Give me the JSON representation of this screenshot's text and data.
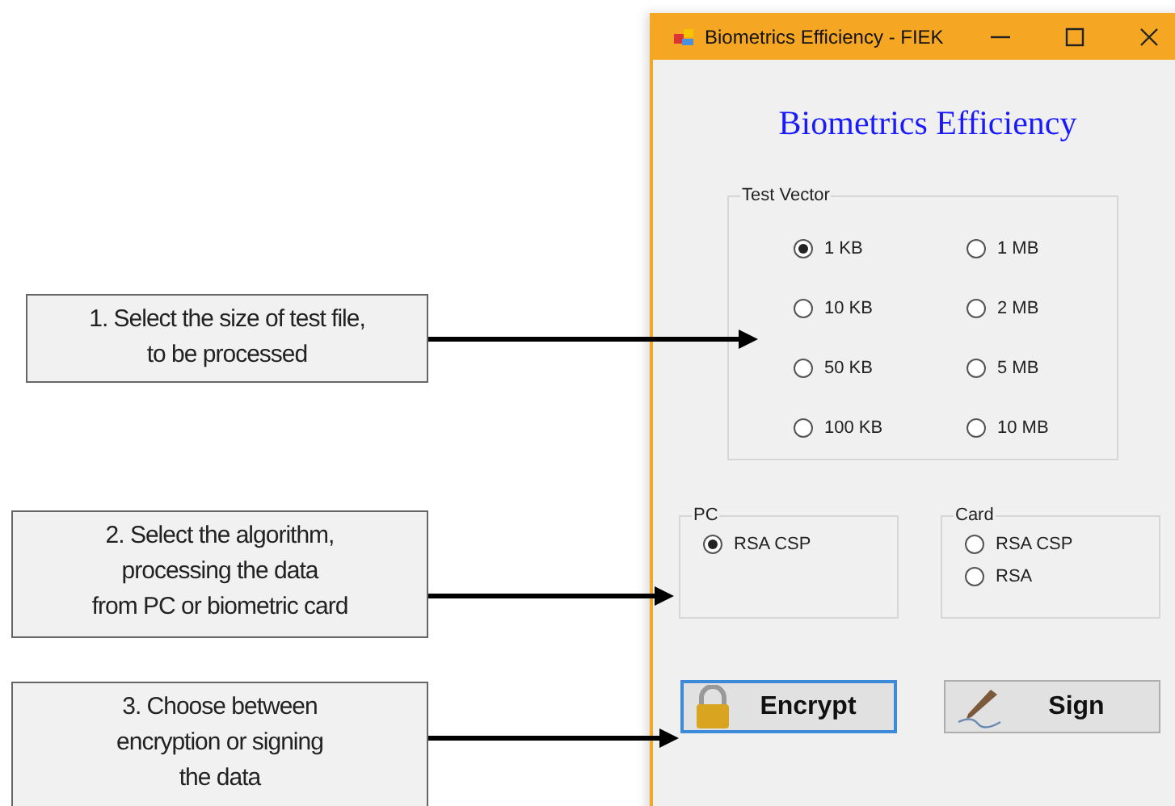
{
  "annotations": [
    {
      "text": "1. Select the size of test file,\nto be processed"
    },
    {
      "text": "2. Select the algorithm,\nprocessing the data\nfrom PC or biometric card"
    },
    {
      "text": "3. Choose between\nencryption or signing\nthe data"
    }
  ],
  "window": {
    "title": "Biometrics Efficiency - FIEK",
    "heading": "Biometrics Efficiency",
    "test_vector": {
      "label": "Test Vector",
      "options": [
        {
          "label": "1 KB",
          "selected": true
        },
        {
          "label": "1 MB",
          "selected": false
        },
        {
          "label": "10 KB",
          "selected": false
        },
        {
          "label": "2 MB",
          "selected": false
        },
        {
          "label": "50 KB",
          "selected": false
        },
        {
          "label": "5 MB",
          "selected": false
        },
        {
          "label": "100 KB",
          "selected": false
        },
        {
          "label": "10 MB",
          "selected": false
        }
      ]
    },
    "pc": {
      "label": "PC",
      "options": [
        {
          "label": "RSA CSP",
          "selected": true
        }
      ]
    },
    "card": {
      "label": "Card",
      "options": [
        {
          "label": "RSA CSP",
          "selected": false
        },
        {
          "label": "RSA",
          "selected": false
        }
      ]
    },
    "buttons": [
      {
        "kind": "encrypt",
        "label": "Encrypt",
        "focused": true
      },
      {
        "kind": "sign",
        "label": "Sign",
        "focused": false
      }
    ]
  }
}
